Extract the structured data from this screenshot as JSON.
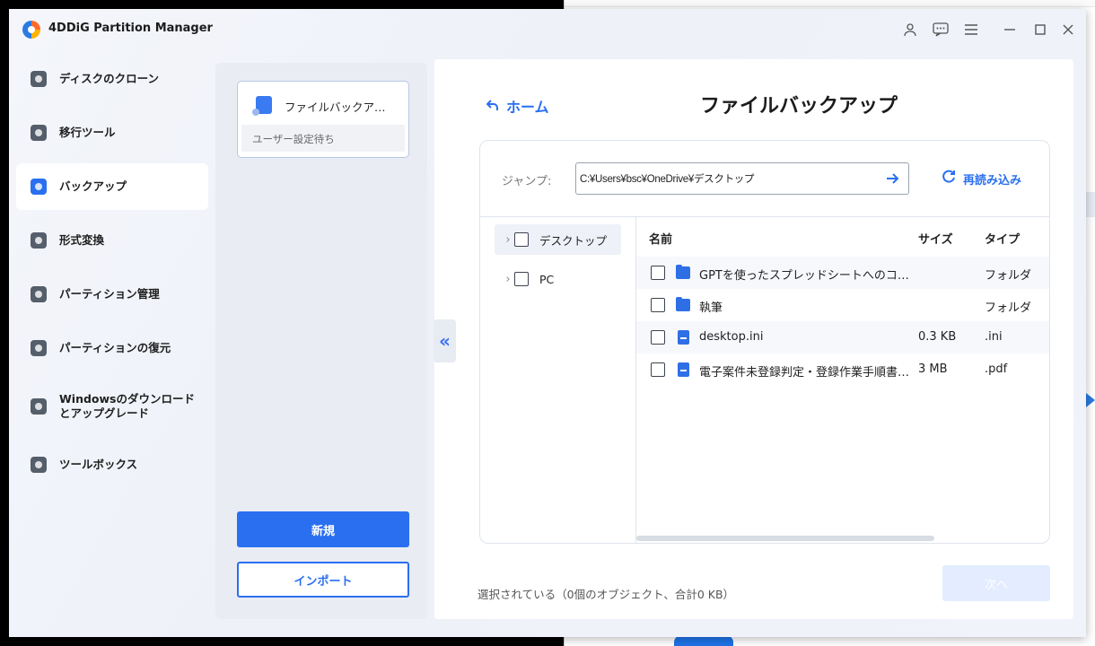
{
  "app": {
    "title": "4DDiG Partition Manager"
  },
  "nav": {
    "items": [
      {
        "label": "ディスクのクローン",
        "icon": "disk-clone-icon"
      },
      {
        "label": "移行ツール",
        "icon": "migrate-icon"
      },
      {
        "label": "バックアップ",
        "icon": "backup-icon",
        "active": true
      },
      {
        "label": "形式変換",
        "icon": "convert-icon"
      },
      {
        "label": "パーティション管理",
        "icon": "partition-icon"
      },
      {
        "label": "パーティションの復元",
        "icon": "partition-restore-icon"
      },
      {
        "label": "Windowsのダウンロードとアップグレード",
        "icon": "windows-download-icon"
      },
      {
        "label": "ツールボックス",
        "icon": "toolbox-icon"
      }
    ]
  },
  "task": {
    "title": "ファイルバックア…",
    "status": "ユーザー設定待ち",
    "new_label": "新規",
    "import_label": "インポート"
  },
  "content": {
    "home_label": "ホーム",
    "page_title": "ファイルバックアップ",
    "jump_label": "ジャンプ:",
    "path_value": "C:¥Users¥bsc¥OneDrive¥デスクトップ",
    "reload_label": "再読み込み"
  },
  "tree": [
    {
      "label": "デスクトップ",
      "selected": true
    },
    {
      "label": "PC",
      "selected": false
    }
  ],
  "list": {
    "headers": {
      "name": "名前",
      "size": "サイズ",
      "type": "タイプ"
    },
    "rows": [
      {
        "name": "GPTを使ったスプレッドシートへのコ…",
        "size": "",
        "type": "フォルダ",
        "kind": "folder"
      },
      {
        "name": "執筆",
        "size": "",
        "type": "フォルダ",
        "kind": "folder"
      },
      {
        "name": "desktop.ini",
        "size": "0.3 KB",
        "type": ".ini",
        "kind": "file"
      },
      {
        "name": "電子案件未登録判定・登録作業手順書…",
        "size": "3 MB",
        "type": ".pdf",
        "kind": "file"
      }
    ]
  },
  "footer": {
    "selection_summary": "選択されている（0個のオブジェクト、合計0 KB）",
    "next_label": "次へ"
  },
  "colors": {
    "accent": "#2a6ff0",
    "next_disabled": "#e3edff"
  }
}
